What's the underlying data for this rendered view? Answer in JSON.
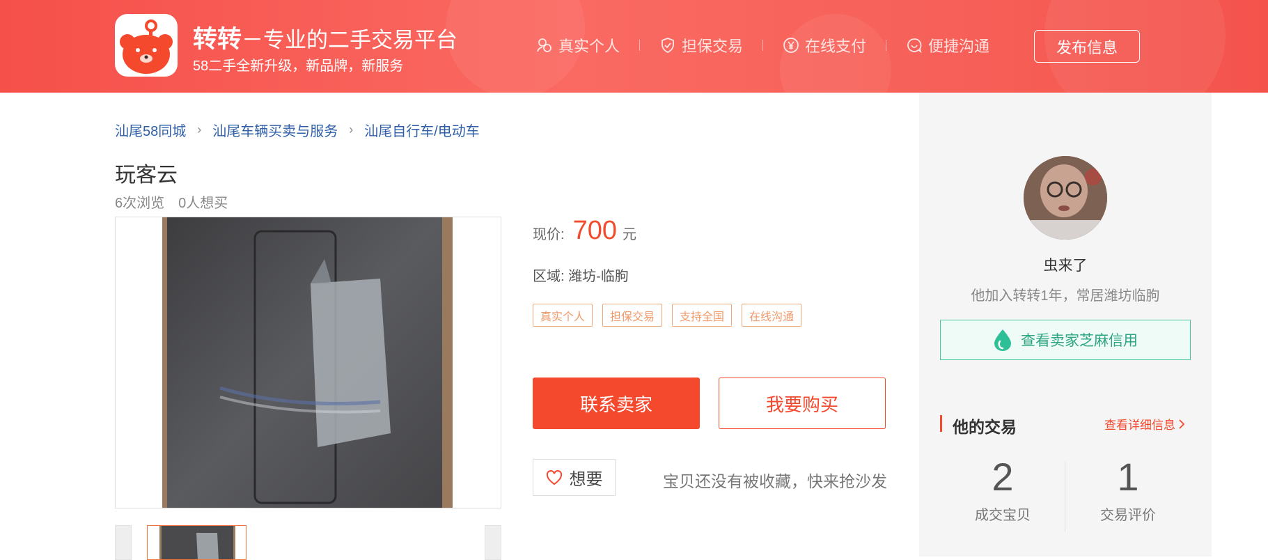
{
  "header": {
    "brand_name": "转转",
    "slogan": "－专业的二手交易平台",
    "subtitle": "58二手全新升级，新品牌，新服务",
    "features": [
      {
        "icon": "people-icon",
        "label": "真实个人"
      },
      {
        "icon": "shield-icon",
        "label": "担保交易"
      },
      {
        "icon": "yuan-coin-icon",
        "label": "在线支付"
      },
      {
        "icon": "chat-smile-icon",
        "label": "便捷沟通"
      }
    ],
    "publish_label": "发布信息"
  },
  "breadcrumb": [
    "汕尾58同城",
    "汕尾车辆买卖与服务",
    "汕尾自行车/电动车"
  ],
  "item": {
    "title": "玩客云",
    "views": "6次浏览",
    "wants": "0人想买",
    "price_label": "现价:",
    "price": "700",
    "price_unit": "元",
    "area": "区域: 潍坊-临朐",
    "tags": [
      "真实个人",
      "担保交易",
      "支持全国",
      "在线沟通"
    ],
    "contact_label": "联系卖家",
    "buy_label": "我要购买",
    "want_label": "想要",
    "fav_note": "宝贝还没有被收藏，快来抢沙发"
  },
  "seller": {
    "name": "虫来了",
    "desc": "他加入转转1年，常居潍坊临朐",
    "credit_label": "查看卖家芝麻信用",
    "trade_title": "他的交易",
    "trade_more": "查看详细信息",
    "stats": [
      {
        "value": "2",
        "label": "成交宝贝"
      },
      {
        "value": "1",
        "label": "交易评价"
      }
    ]
  },
  "colors": {
    "header_red": "#f6504a",
    "accent": "#f4492d",
    "link_blue": "#2e5ea8",
    "tag_orange": "#f0996a",
    "credit_green": "#2ea583"
  }
}
